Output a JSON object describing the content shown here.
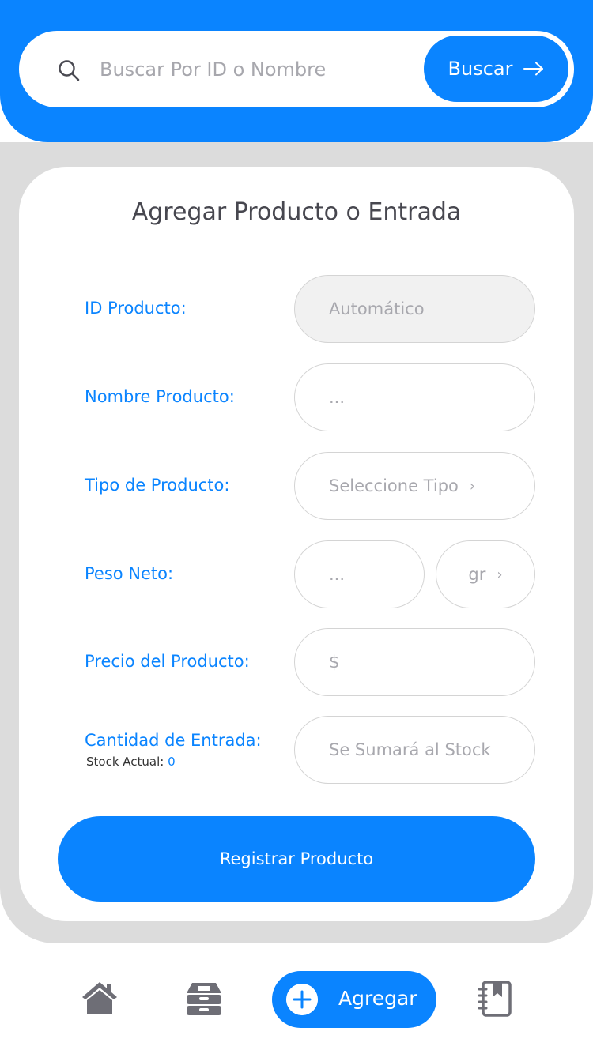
{
  "search": {
    "placeholder": "Buscar Por ID o Nombre",
    "button_label": "Buscar",
    "icon": "search-icon",
    "button_icon": "arrow-right-icon"
  },
  "form": {
    "title": "Agregar Producto o Entrada",
    "id_label": "ID Producto:",
    "id_value": "Automático",
    "name_label": "Nombre Producto:",
    "name_placeholder": "...",
    "type_label": "Tipo de Producto:",
    "type_placeholder": "Seleccione Tipo",
    "weight_label": "Peso Neto:",
    "weight_placeholder": "...",
    "weight_unit": "gr",
    "price_label": "Precio del Producto:",
    "price_placeholder": "$",
    "quantity_label": "Cantidad de Entrada:",
    "quantity_placeholder": "Se Sumará al Stock",
    "stock_label": "Stock Actual:",
    "stock_value": "0",
    "submit_label": "Registrar Producto"
  },
  "nav": {
    "items": [
      {
        "icon": "home-icon"
      },
      {
        "icon": "inventory-icon"
      },
      {
        "icon": "add-icon",
        "label": "Agregar",
        "active": true
      },
      {
        "icon": "notebook-icon"
      }
    ]
  },
  "colors": {
    "accent": "#0a84ff",
    "frame": "#dcdcdc",
    "nav_icon": "#6e6e76"
  }
}
